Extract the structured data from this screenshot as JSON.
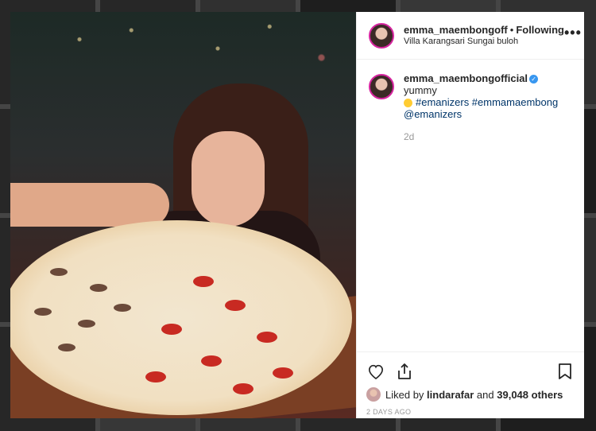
{
  "post": {
    "author": "emma_maembongoff",
    "separator": "•",
    "follow_status": "Following",
    "location": "Villa Karangsari Sungai buloh",
    "more": "•••"
  },
  "caption": {
    "user": "emma_maembongofficial",
    "text": "yummy",
    "tags": "#emanizers #emmamaembong",
    "mention": "@emanizers",
    "age": "2d"
  },
  "likes": {
    "prefix": "Liked by",
    "user": "lindarafar",
    "and": "and",
    "count": "39,048 others"
  },
  "post_date": "2 DAYS AGO",
  "icons": [
    "heart-icon",
    "share-icon",
    "bookmark-icon",
    "more-icon",
    "verified-icon"
  ],
  "colors": {
    "accent": "#3897f0",
    "hashtag": "#003569",
    "muted": "#999999"
  }
}
